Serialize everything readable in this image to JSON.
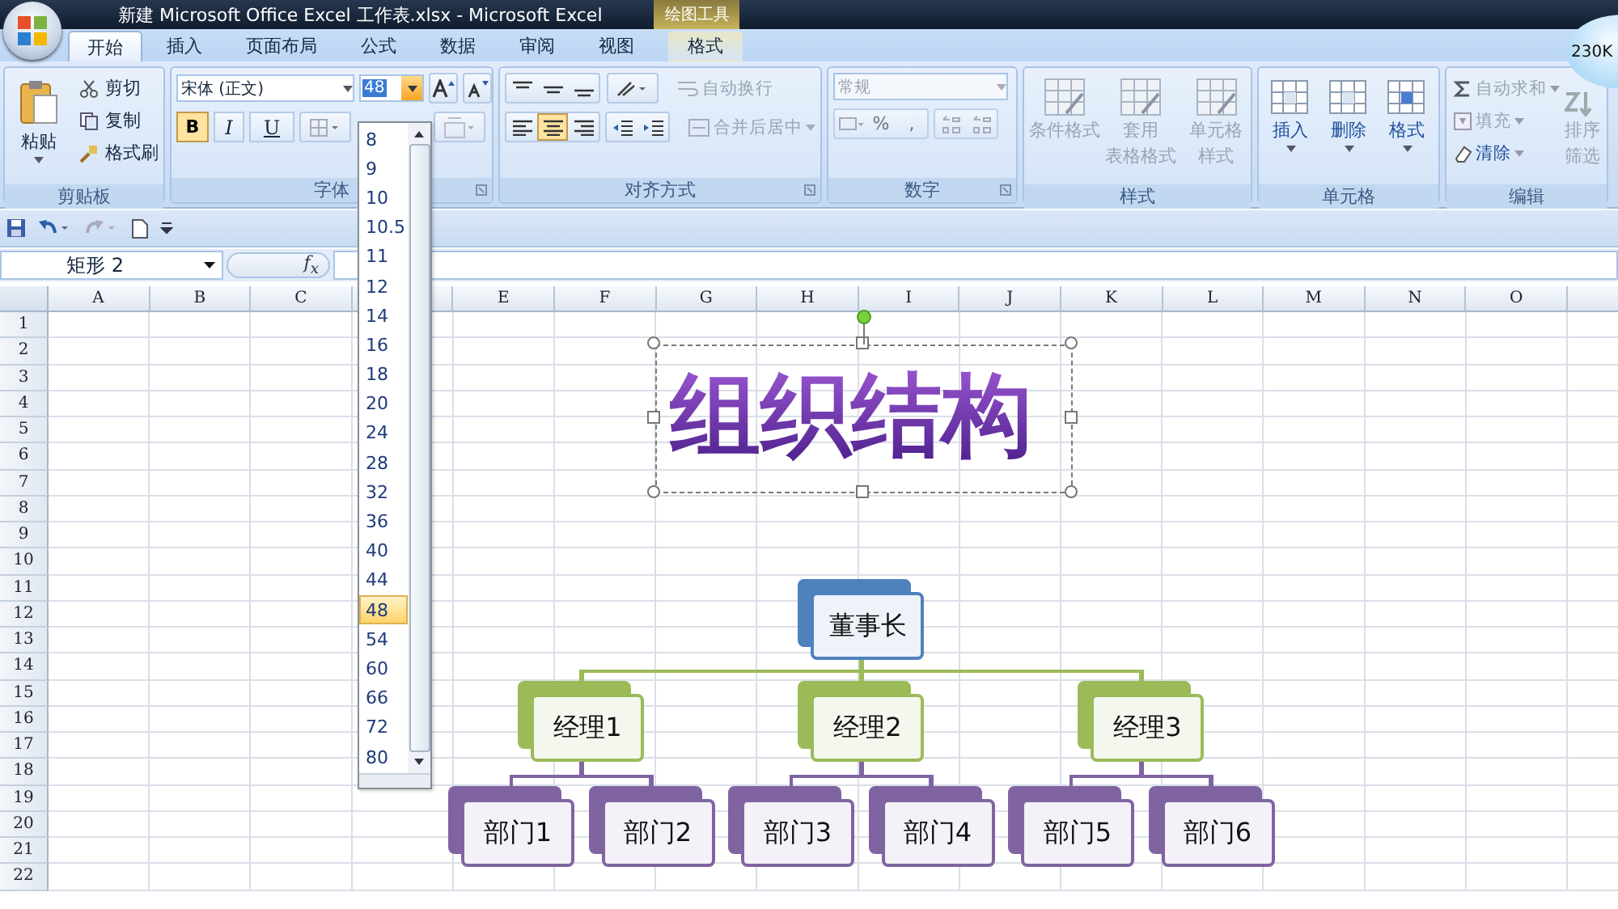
{
  "window": {
    "title": "新建 Microsoft Office Excel 工作表.xlsx - Microsoft Excel",
    "context_group": "绘图工具"
  },
  "badge": "230K",
  "tabs": [
    {
      "label": "开始",
      "selected": true
    },
    {
      "label": "插入",
      "selected": false
    },
    {
      "label": "页面布局",
      "selected": false
    },
    {
      "label": "公式",
      "selected": false
    },
    {
      "label": "数据",
      "selected": false
    },
    {
      "label": "审阅",
      "selected": false
    },
    {
      "label": "视图",
      "selected": false
    },
    {
      "label": "格式",
      "selected": false
    }
  ],
  "clipboard": {
    "label": "剪贴板",
    "paste": "粘贴",
    "items": [
      "剪切",
      "复制",
      "格式刷"
    ]
  },
  "font": {
    "label": "字体",
    "font_name": "宋体 (正文)",
    "font_size": "48",
    "bold": {
      "label": "B",
      "on": true
    },
    "italic": {
      "label": "I",
      "on": false
    },
    "underline": {
      "label": "U",
      "on": false
    }
  },
  "alignment": {
    "label": "对齐方式",
    "wrap_text": {
      "text": "自动换行",
      "disabled": true
    },
    "merge": {
      "text": "合并后居中",
      "disabled": true
    },
    "align": [
      {
        "kind": "left",
        "on": false
      },
      {
        "kind": "center",
        "on": true
      },
      {
        "kind": "right",
        "on": false
      }
    ]
  },
  "number": {
    "label": "数字",
    "format": "常规",
    "percent": "%",
    "comma": ","
  },
  "styles": {
    "label": "样式",
    "buttons": [
      {
        "lines": [
          "条件格式"
        ],
        "disabled": true
      },
      {
        "lines": [
          "套用",
          "表格格式"
        ],
        "disabled": true
      },
      {
        "lines": [
          "单元格",
          "样式"
        ],
        "disabled": true
      }
    ]
  },
  "cells": {
    "label": "单元格",
    "buttons": [
      "插入",
      "删除",
      "格式"
    ]
  },
  "editing": {
    "label": "编辑",
    "items": [
      {
        "text": "自动求和",
        "disabled": true
      },
      {
        "text": "填充",
        "disabled": true
      },
      {
        "text": "清除",
        "disabled": false
      }
    ],
    "sort": [
      "排序",
      "筛选"
    ]
  },
  "name_box": "矩形 2",
  "function_label": "f$_{x}$",
  "columns_left": [
    "A",
    "B",
    "C"
  ],
  "columns_right": [
    "E",
    "F",
    "G",
    "H",
    "I",
    "J",
    "K",
    "L",
    "M",
    "N",
    "O"
  ],
  "rows": [
    "1",
    "2",
    "3",
    "4",
    "5",
    "6",
    "7",
    "8",
    "9",
    "10",
    "11",
    "12",
    "13",
    "14",
    "15",
    "16",
    "17",
    "18",
    "19",
    "20",
    "21",
    "22"
  ],
  "font_size_list": [
    {
      "label": "8",
      "selected": false
    },
    {
      "label": "9",
      "selected": false
    },
    {
      "label": "10",
      "selected": false
    },
    {
      "label": "10.5",
      "selected": false
    },
    {
      "label": "11",
      "selected": false
    },
    {
      "label": "12",
      "selected": false
    },
    {
      "label": "14",
      "selected": false
    },
    {
      "label": "16",
      "selected": false
    },
    {
      "label": "18",
      "selected": false
    },
    {
      "label": "20",
      "selected": false
    },
    {
      "label": "24",
      "selected": false
    },
    {
      "label": "28",
      "selected": false
    },
    {
      "label": "32",
      "selected": false
    },
    {
      "label": "36",
      "selected": false
    },
    {
      "label": "40",
      "selected": false
    },
    {
      "label": "44",
      "selected": false
    },
    {
      "label": "48",
      "selected": true
    },
    {
      "label": "54",
      "selected": false
    },
    {
      "label": "60",
      "selected": false
    },
    {
      "label": "66",
      "selected": false
    },
    {
      "label": "72",
      "selected": false
    },
    {
      "label": "80",
      "selected": false
    }
  ],
  "wordart": "组织结构",
  "org_chart": {
    "label": "董事长",
    "children": [
      {
        "label": "经理1",
        "children": [
          {
            "label": "部门1"
          },
          {
            "label": "部门2"
          }
        ]
      },
      {
        "label": "经理2",
        "children": [
          {
            "label": "部门3"
          },
          {
            "label": "部门4"
          }
        ]
      },
      {
        "label": "经理3",
        "children": [
          {
            "label": "部门5"
          },
          {
            "label": "部门6"
          }
        ]
      }
    ]
  }
}
